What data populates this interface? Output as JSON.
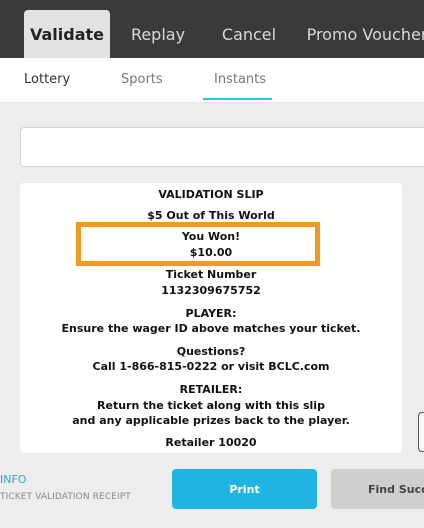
{
  "top_tabs": [
    "Validate",
    "Replay",
    "Cancel",
    "Promo Voucher"
  ],
  "sub_tabs": [
    "Lottery",
    "Sports",
    "Instants"
  ],
  "slip": {
    "header": "VALIDATION SLIP",
    "game": "$5 Out of This World",
    "won_label": "You Won!",
    "won_amount": "$10.00",
    "ticket_label": "Ticket Number",
    "ticket_number": "1132309675752",
    "player_heading": "PLAYER:",
    "player_text": "Ensure the wager ID above matches your ticket.",
    "questions_heading": "Questions?",
    "questions_text": "Call 1-866-815-0222 or visit BCLC.com",
    "retailer_heading": "RETAILER:",
    "retailer_text_1": "Return the ticket along with this slip",
    "retailer_text_2": "and any applicable prizes back to the player.",
    "retailer_id": "Retailer 10020"
  },
  "footer": {
    "info": "INFO",
    "receipt": "TICKET VALIDATION RECEIPT",
    "print": "Print",
    "find": "Find Succe"
  },
  "colors": {
    "accent": "#1fb4e2",
    "highlight": "#f39a1d",
    "topbar": "#3a3a3a"
  }
}
